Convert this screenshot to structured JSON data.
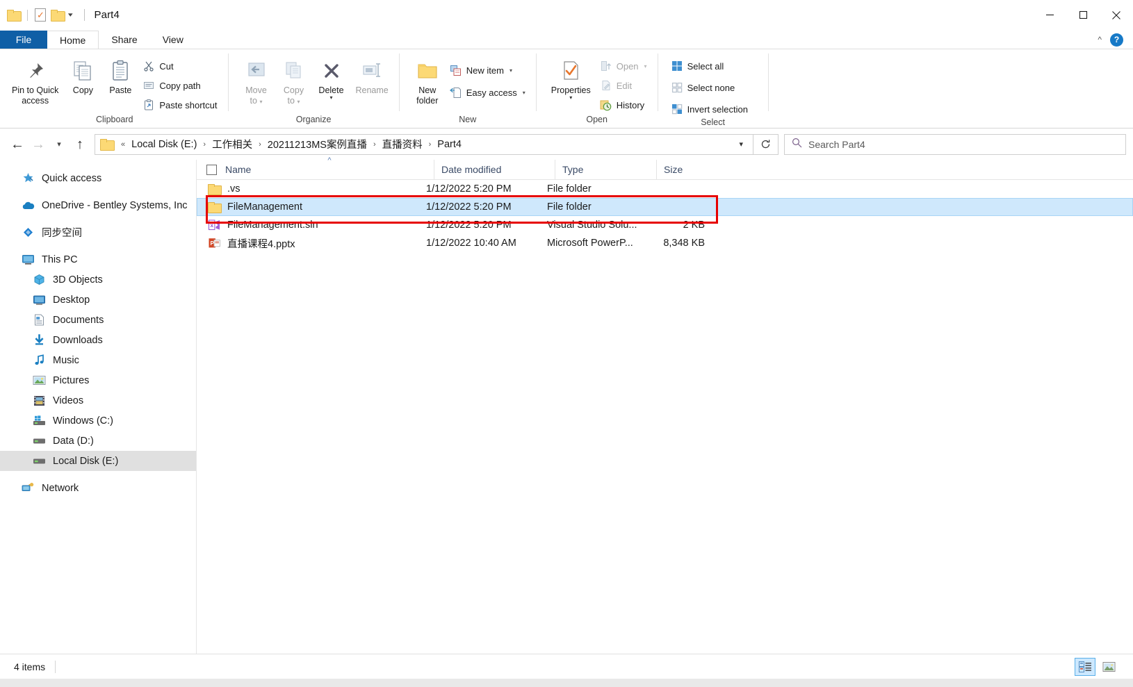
{
  "window": {
    "title": "Part4",
    "quick_access": [
      "folder-icon",
      "checked-document-icon",
      "folder-icon",
      "dropdown-caret-icon"
    ],
    "controls": {
      "minimize": "minimize-icon",
      "maximize": "maximize-icon",
      "close": "close-icon"
    }
  },
  "tabs": [
    {
      "label": "File",
      "id": "file"
    },
    {
      "label": "Home",
      "id": "home"
    },
    {
      "label": "Share",
      "id": "share"
    },
    {
      "label": "View",
      "id": "view"
    }
  ],
  "tab_active": "Home",
  "ribbon_right": {
    "collapse": "chevron-up-icon",
    "help": "?"
  },
  "ribbon": {
    "groups": [
      {
        "label": "Clipboard",
        "big": [
          {
            "label": "Pin to Quick\naccess",
            "line1": "Pin to Quick",
            "line2": "access",
            "icon": "pin-icon",
            "disabled": false
          },
          {
            "label": "Copy",
            "line1": "Copy",
            "line2": "",
            "icon": "copy-icon",
            "disabled": false
          },
          {
            "label": "Paste",
            "line1": "Paste",
            "line2": "",
            "icon": "paste-icon",
            "disabled": false
          }
        ],
        "small": [
          {
            "label": "Cut",
            "icon": "scissors-icon",
            "disabled": false
          },
          {
            "label": "Copy path",
            "icon": "copy-path-icon",
            "disabled": false
          },
          {
            "label": "Paste shortcut",
            "icon": "paste-shortcut-icon",
            "disabled": false
          }
        ]
      },
      {
        "label": "Organize",
        "big": [
          {
            "line1": "Move",
            "line2": "to",
            "icon": "move-to-icon",
            "disabled": true,
            "caret": true
          },
          {
            "line1": "Copy",
            "line2": "to",
            "icon": "copy-to-icon",
            "disabled": true,
            "caret": true
          },
          {
            "line1": "Delete",
            "line2": "",
            "icon": "delete-icon",
            "disabled": false,
            "caret": true
          },
          {
            "line1": "Rename",
            "line2": "",
            "icon": "rename-icon",
            "disabled": true,
            "caret": false
          }
        ],
        "small": []
      },
      {
        "label": "New",
        "big": [
          {
            "line1": "New",
            "line2": "folder",
            "icon": "new-folder-icon",
            "disabled": false
          }
        ],
        "small": [
          {
            "label": "New item",
            "icon": "new-item-icon",
            "disabled": false,
            "caret": true
          },
          {
            "label": "Easy access",
            "icon": "easy-access-icon",
            "disabled": false,
            "caret": true
          }
        ]
      },
      {
        "label": "Open",
        "big": [
          {
            "line1": "Properties",
            "line2": "",
            "icon": "properties-icon",
            "disabled": false,
            "caret": true
          }
        ],
        "small": [
          {
            "label": "Open",
            "icon": "open-icon",
            "disabled": true,
            "caret": true
          },
          {
            "label": "Edit",
            "icon": "edit-icon",
            "disabled": true
          },
          {
            "label": "History",
            "icon": "history-icon",
            "disabled": false
          }
        ]
      },
      {
        "label": "Select",
        "big": [],
        "small": [
          {
            "label": "Select all",
            "icon": "select-all-icon",
            "disabled": false
          },
          {
            "label": "Select none",
            "icon": "select-none-icon",
            "disabled": false
          },
          {
            "label": "Invert selection",
            "icon": "invert-selection-icon",
            "disabled": false
          }
        ]
      }
    ]
  },
  "address": {
    "back": "back-arrow-icon",
    "forward": "forward-arrow-icon",
    "recent": "recent-locations-icon",
    "up": "up-arrow-icon",
    "leading": "«",
    "crumbs": [
      "Local Disk (E:)",
      "工作相关",
      "20211213MS案例直播",
      "直播资料",
      "Part4"
    ],
    "separator": "›",
    "dropdown": "chevron-down-icon",
    "refresh": "refresh-icon"
  },
  "search": {
    "placeholder": "Search Part4",
    "icon": "search-icon"
  },
  "sidebar": {
    "items": [
      {
        "label": "Quick access",
        "icon": "star-pin-icon",
        "indent": false,
        "selected": false,
        "gap_before": false
      },
      {
        "label": "OneDrive - Bentley Systems, Inc",
        "icon": "onedrive-cloud-icon",
        "indent": false,
        "selected": false,
        "gap_before": true
      },
      {
        "label": "同步空间",
        "icon": "sync-space-icon",
        "indent": false,
        "selected": false,
        "gap_before": true
      },
      {
        "label": "This PC",
        "icon": "this-pc-icon",
        "indent": false,
        "selected": false,
        "gap_before": true
      },
      {
        "label": "3D Objects",
        "icon": "3d-objects-icon",
        "indent": true,
        "selected": false,
        "gap_before": false
      },
      {
        "label": "Desktop",
        "icon": "desktop-icon",
        "indent": true,
        "selected": false,
        "gap_before": false
      },
      {
        "label": "Documents",
        "icon": "documents-icon",
        "indent": true,
        "selected": false,
        "gap_before": false
      },
      {
        "label": "Downloads",
        "icon": "downloads-icon",
        "indent": true,
        "selected": false,
        "gap_before": false
      },
      {
        "label": "Music",
        "icon": "music-icon",
        "indent": true,
        "selected": false,
        "gap_before": false
      },
      {
        "label": "Pictures",
        "icon": "pictures-icon",
        "indent": true,
        "selected": false,
        "gap_before": false
      },
      {
        "label": "Videos",
        "icon": "videos-icon",
        "indent": true,
        "selected": false,
        "gap_before": false
      },
      {
        "label": "Windows (C:)",
        "icon": "windows-drive-icon",
        "indent": true,
        "selected": false,
        "gap_before": false
      },
      {
        "label": "Data (D:)",
        "icon": "drive-icon",
        "indent": true,
        "selected": false,
        "gap_before": false
      },
      {
        "label": "Local Disk (E:)",
        "icon": "drive-icon",
        "indent": true,
        "selected": true,
        "gap_before": false
      },
      {
        "label": "Network",
        "icon": "network-icon",
        "indent": false,
        "selected": false,
        "gap_before": true
      }
    ]
  },
  "filelist": {
    "columns": [
      {
        "label": "Name",
        "sorted": true,
        "sort_dir": "asc"
      },
      {
        "label": "Date modified",
        "sorted": false
      },
      {
        "label": "Type",
        "sorted": false
      },
      {
        "label": "Size",
        "sorted": false
      }
    ],
    "rows": [
      {
        "name": ".vs",
        "date": "1/12/2022 5:20 PM",
        "type": "File folder",
        "size": "",
        "icon": "folder-icon",
        "selected": false
      },
      {
        "name": "FileManagement",
        "date": "1/12/2022 5:20 PM",
        "type": "File folder",
        "size": "",
        "icon": "folder-icon",
        "selected": true
      },
      {
        "name": "FileManagement.sln",
        "date": "1/12/2022 5:20 PM",
        "type": "Visual Studio Solu...",
        "size": "2 KB",
        "icon": "visual-studio-icon",
        "selected": false
      },
      {
        "name": "直播课程4.pptx",
        "date": "1/12/2022 10:40 AM",
        "type": "Microsoft PowerP...",
        "size": "8,348 KB",
        "icon": "powerpoint-icon",
        "selected": false
      }
    ],
    "annotation": {
      "color": "#e60000",
      "target_row": "FileManagement"
    }
  },
  "statusbar": {
    "item_count": "4 items",
    "views": [
      {
        "name": "details-view-button",
        "active": true
      },
      {
        "name": "large-icons-view-button",
        "active": false
      }
    ]
  },
  "colors": {
    "accent": "#0f5fa6",
    "selection": "#cfe8fc",
    "annotation": "#e60000",
    "folder": "#fcd975"
  }
}
